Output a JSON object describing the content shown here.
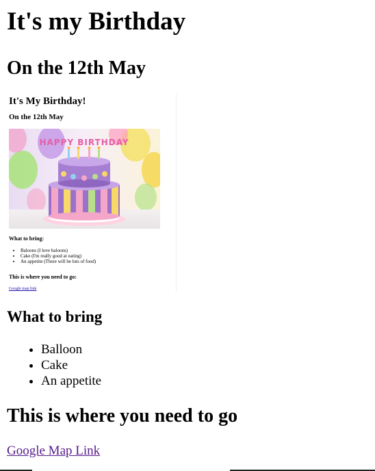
{
  "page": {
    "title": "It's my Birthday",
    "date_heading": "On the 12th May",
    "bring_heading": "What to bring",
    "bring_items": [
      "Balloon",
      "Cake",
      "An appetite"
    ],
    "go_heading": "This is where you need to go",
    "map_link": "Google Map Link"
  },
  "preview": {
    "title": "It's My Birthday!",
    "date_heading": "On the 12th May",
    "cake_topper": "HAPPY BIRTHDAY",
    "bring_heading": "What to bring:",
    "bring_items": [
      "Baloons (I love baloons)",
      "Cake (I'm really good at eating)",
      "An appetite (There will be lots of food)"
    ],
    "go_heading": "This is where you need to go:",
    "map_link": "Google map link"
  },
  "colors": {
    "link_visited": "#551a8b",
    "link": "#1a0dab",
    "cake_purple": "#9b72c9",
    "cake_pink": "#f3a6c8"
  }
}
